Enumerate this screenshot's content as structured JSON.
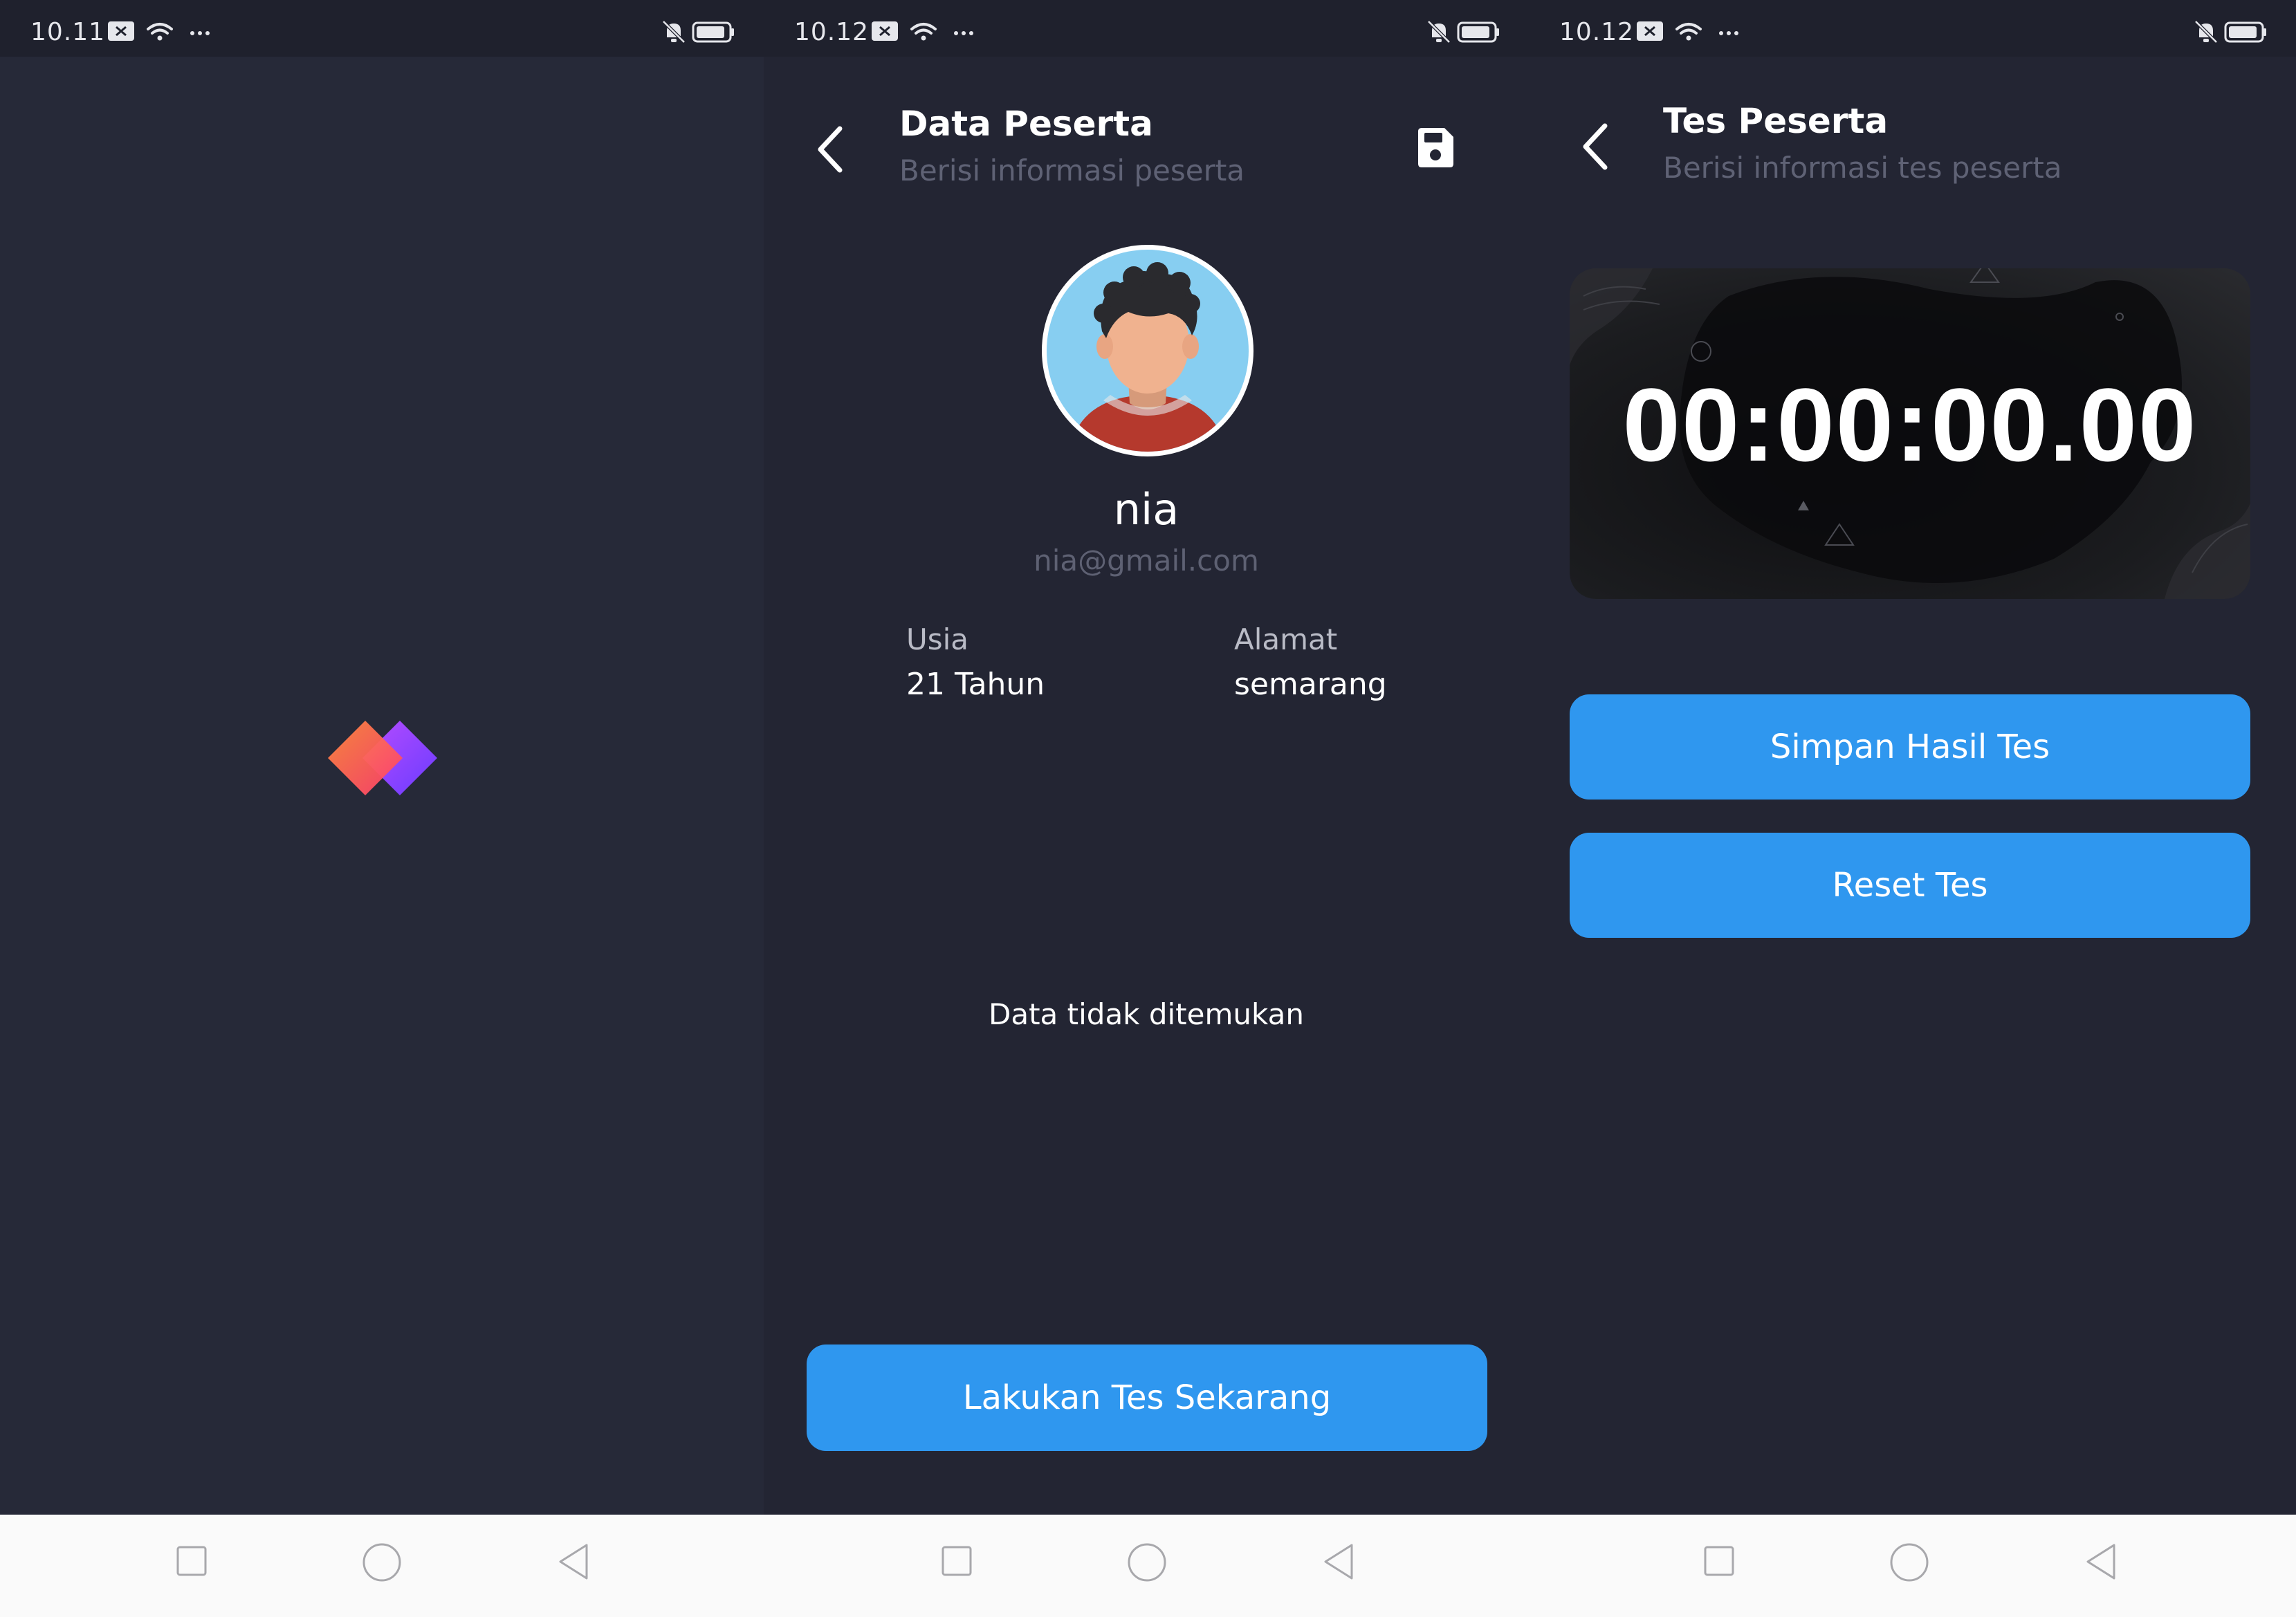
{
  "screens": [
    {
      "id": "splash",
      "status_time": "10.11"
    },
    {
      "id": "participant",
      "status_time": "10.12",
      "title": "Data Peserta",
      "subtitle": "Berisi informasi peserta",
      "name": "nia",
      "email": "nia@gmail.com",
      "age_label": "Usia",
      "age_value": "21 Tahun",
      "address_label": "Alamat",
      "address_value": "semarang",
      "empty_message": "Data tidak ditemukan",
      "primary_button": "Lakukan Tes Sekarang"
    },
    {
      "id": "test",
      "status_time": "10.12",
      "title": "Tes Peserta",
      "subtitle": "Berisi informasi tes peserta",
      "timer": "00:00:00.00",
      "save_button": "Simpan Hasil Tes",
      "reset_button": "Reset Tes"
    }
  ],
  "icons": {
    "status": [
      "message-icon",
      "wifi-icon",
      "more-dots-icon",
      "mute-bell-icon",
      "battery-icon"
    ],
    "app": [
      "back-arrow-icon",
      "save-floppy-icon",
      "app-logo-icon"
    ],
    "nav": [
      "recent-apps-icon",
      "home-icon",
      "back-icon"
    ]
  },
  "colors": {
    "background": "#242636",
    "primary": "#2f97ef",
    "text_primary": "#ffffff",
    "text_muted": "#5f6275"
  }
}
